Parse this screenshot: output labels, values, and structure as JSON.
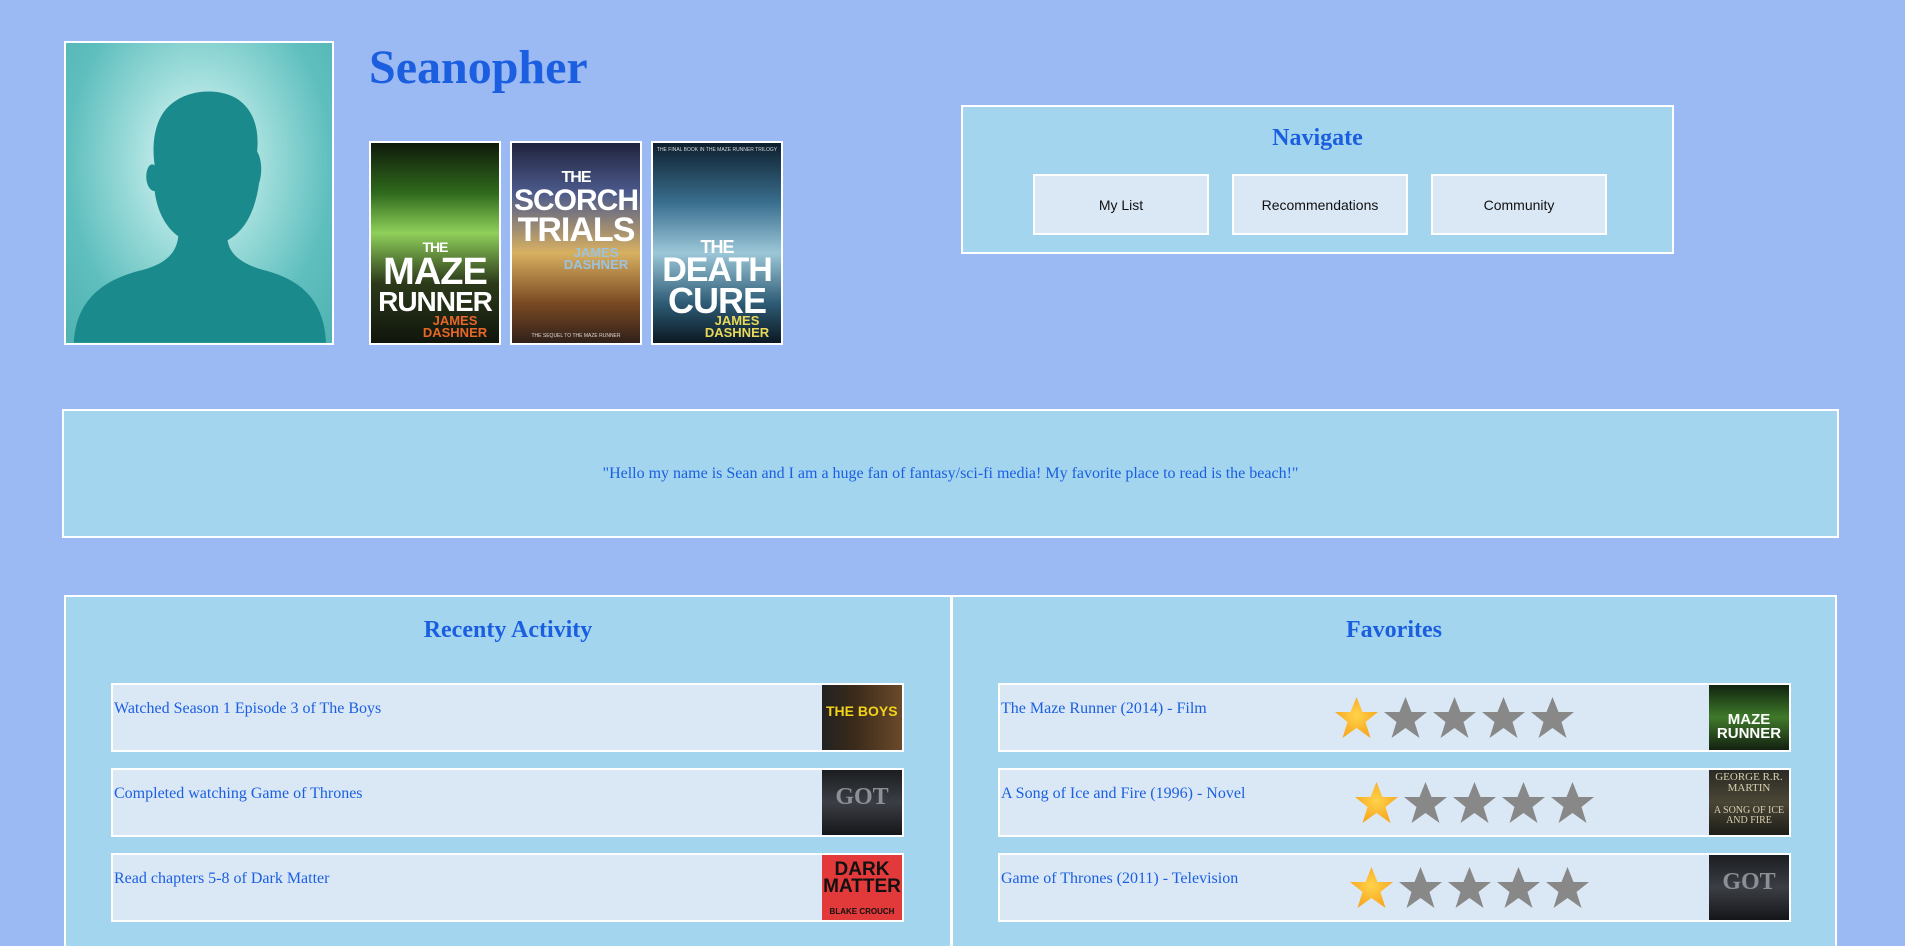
{
  "profile": {
    "username": "Seanopher"
  },
  "covers": [
    {
      "title_top": "THE",
      "title_main": "MAZE",
      "title_sub": "RUNNER",
      "author": "JAMES DASHNER",
      "tagline": ""
    },
    {
      "title_top": "THE",
      "title_main": "SCORCH",
      "title_sub": "TRIALS",
      "author": "JAMES DASHNER",
      "tagline": "THE SEQUEL TO THE MAZE RUNNER"
    },
    {
      "title_top": "THE",
      "title_main": "DEATH",
      "title_sub": "CURE",
      "author": "JAMES DASHNER",
      "tagline": "THE FINAL BOOK IN THE MAZE RUNNER TRILOGY"
    }
  ],
  "navigate": {
    "title": "Navigate",
    "buttons": [
      "My List",
      "Recommendations",
      "Community"
    ]
  },
  "bio": {
    "text": "\"Hello my name is Sean and I am a huge fan of fantasy/sci-fi media! My favorite place to read is the beach!\""
  },
  "recent": {
    "title": "Recenty Activity",
    "items": [
      {
        "text": "Watched Season 1 Episode 3 of The Boys",
        "thumb_label": "THE BOYS"
      },
      {
        "text": "Completed watching Game of Thrones",
        "thumb_label": "GOT"
      },
      {
        "text": "Read chapters 5-8 of Dark Matter",
        "thumb_label": "DARK MATTER",
        "thumb_author": "BLAKE CROUCH"
      }
    ]
  },
  "favorites": {
    "title": "Favorites",
    "items": [
      {
        "text": "The Maze Runner (2014) - Film",
        "rating": 1,
        "max": 5,
        "thumb_label": "MAZE RUNNER"
      },
      {
        "text": "A Song of Ice and Fire (1996) - Novel",
        "rating": 1,
        "max": 5,
        "thumb_label": "GEORGE R.R. MARTIN",
        "thumb_sub": "A SONG OF ICE AND FIRE"
      },
      {
        "text": "Game of Thrones (2011) - Television",
        "rating": 1,
        "max": 5,
        "thumb_label": "GOT"
      }
    ]
  },
  "colors": {
    "background": "#9bbaf4",
    "panel": "#a3d5ef",
    "row": "#dae8f6",
    "accent_text": "#1b5fe0",
    "star_filled": "#f7a21b",
    "star_empty": "#888888"
  }
}
